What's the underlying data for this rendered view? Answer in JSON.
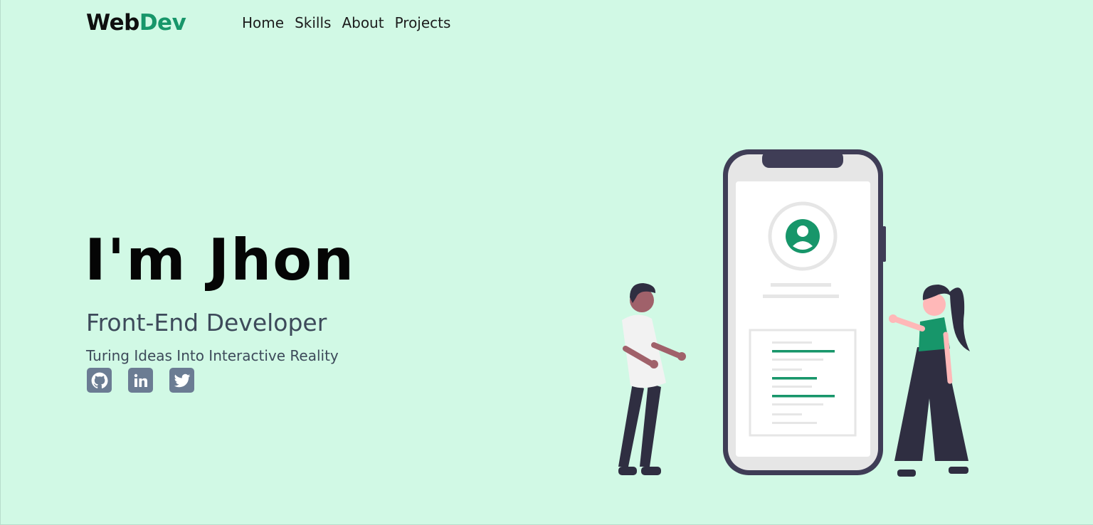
{
  "header": {
    "logo_part1": "Web",
    "logo_part2": "Dev",
    "nav": [
      "Home",
      "Skills",
      "About",
      "Projects"
    ]
  },
  "hero": {
    "title": "I'm Jhon",
    "role": "Front-End Developer",
    "tagline": "Turing Ideas Into Interactive Reality"
  },
  "socials": [
    {
      "icon": "github-icon"
    },
    {
      "icon": "linkedin-icon"
    },
    {
      "icon": "twitter-icon"
    }
  ],
  "colors": {
    "background": "#d1f9e5",
    "accent": "#17966a",
    "text": "#3d4a5a",
    "icon": "#6b7c93",
    "phone_frame": "#3f3d56"
  }
}
